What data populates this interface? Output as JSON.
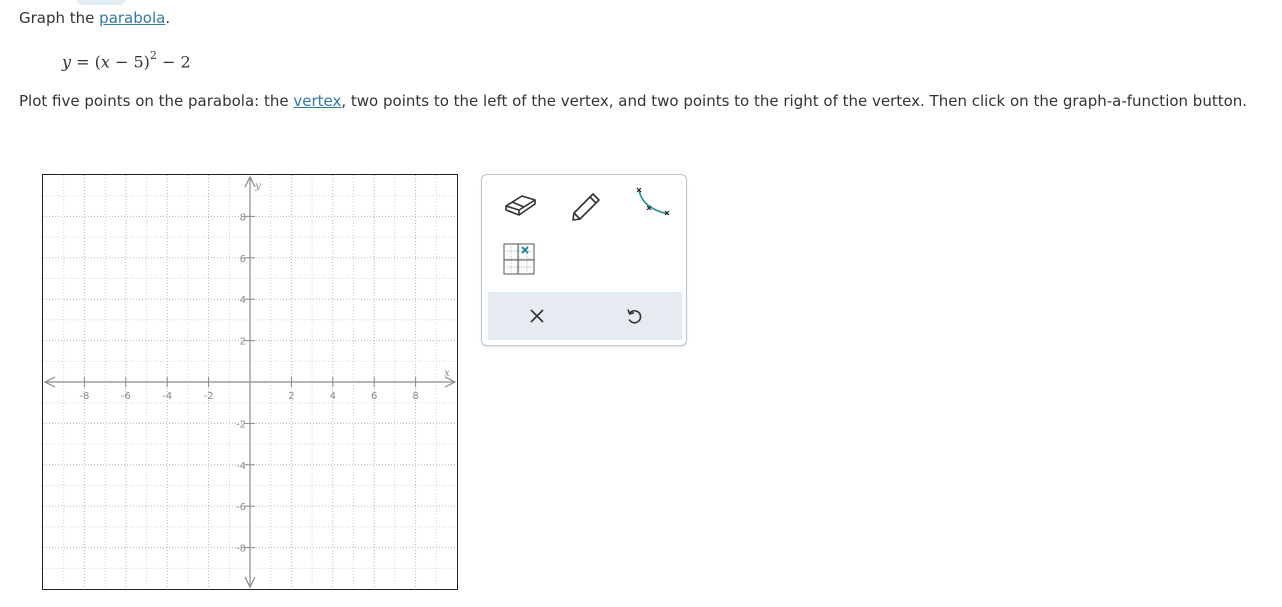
{
  "problem": {
    "prompt_prefix": "Graph the ",
    "prompt_link": "parabola",
    "prompt_suffix": ".",
    "equation": {
      "lhs": "y",
      "equals": " = ",
      "open": "(",
      "var": "x",
      "minus_part": " − 5)",
      "exponent": "2",
      "tail": " − 2"
    },
    "instructions_1": "Plot five points on the parabola: the ",
    "instructions_link": "vertex",
    "instructions_2": ", two points to the left of the vertex, and two points to the right of the vertex. Then click on the graph-a-function button."
  },
  "graph": {
    "x_axis_label": "x",
    "y_axis_label": "y",
    "xlim": [
      -10,
      10
    ],
    "ylim": [
      -10,
      10
    ],
    "grid_step": 1,
    "x_ticks": [
      -8,
      -6,
      -4,
      -2,
      2,
      4,
      6,
      8
    ],
    "y_ticks": [
      8,
      6,
      4,
      2,
      -2,
      -4,
      -6,
      -8
    ],
    "tick_labels_x": [
      "-8",
      "-6",
      "-4",
      "-2",
      "2",
      "4",
      "6",
      "8"
    ],
    "tick_labels_y": [
      "8",
      "6",
      "4",
      "2",
      "-2",
      "-4",
      "-6",
      "-8"
    ]
  },
  "toolbox": {
    "tools": [
      "eraser-icon",
      "pencil-icon",
      "graph-a-function-icon",
      "point-grid-icon"
    ],
    "clear_symbol": "✕",
    "undo_symbol": "↺",
    "accent_color": "#1e8e9e"
  }
}
